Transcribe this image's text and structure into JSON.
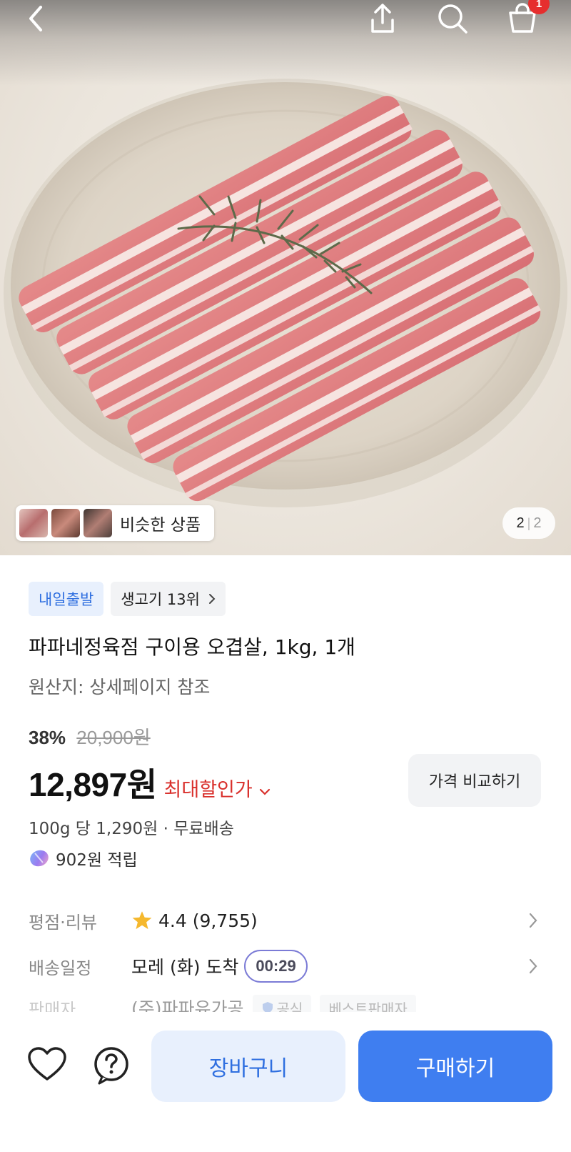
{
  "header": {
    "cart_count": "1"
  },
  "gallery": {
    "similar_label": "비슷한 상품",
    "current_page": "2",
    "total_pages": "2"
  },
  "product": {
    "delivery_chip": "내일출발",
    "rank_chip": "생고기 13위",
    "title": "파파네정육점 구이용 오겹살, 1kg, 1개",
    "origin": "원산지: 상세페이지 참조",
    "discount_pct": "38%",
    "original_price": "20,900원",
    "price": "12,897원",
    "price_label": "최대할인가",
    "compare_button": "가격 비교하기",
    "unit_price": "100g 당 1,290원 · 무료배송",
    "points": "902원 적립"
  },
  "info": {
    "rating_key": "평점·리뷰",
    "rating_value": "4.4 (9,755)",
    "shipping_key": "배송일정",
    "shipping_value": "모레 (화) 도착",
    "shipping_timer": "00:29",
    "seller_key": "판매자",
    "seller_value": "(주)파파유가공",
    "seller_badge_official": "공식",
    "seller_badge_best": "베스트판매자"
  },
  "actions": {
    "cart_button": "장바구니",
    "buy_button": "구매하기"
  },
  "colors": {
    "accent_blue": "#3f7ef0",
    "sale_red": "#d9302c",
    "badge_red": "#e62e2e"
  },
  "icons": [
    "back-icon",
    "share-icon",
    "search-icon",
    "cart-icon",
    "star-icon",
    "chevron-right-icon",
    "heart-icon",
    "help-icon"
  ]
}
